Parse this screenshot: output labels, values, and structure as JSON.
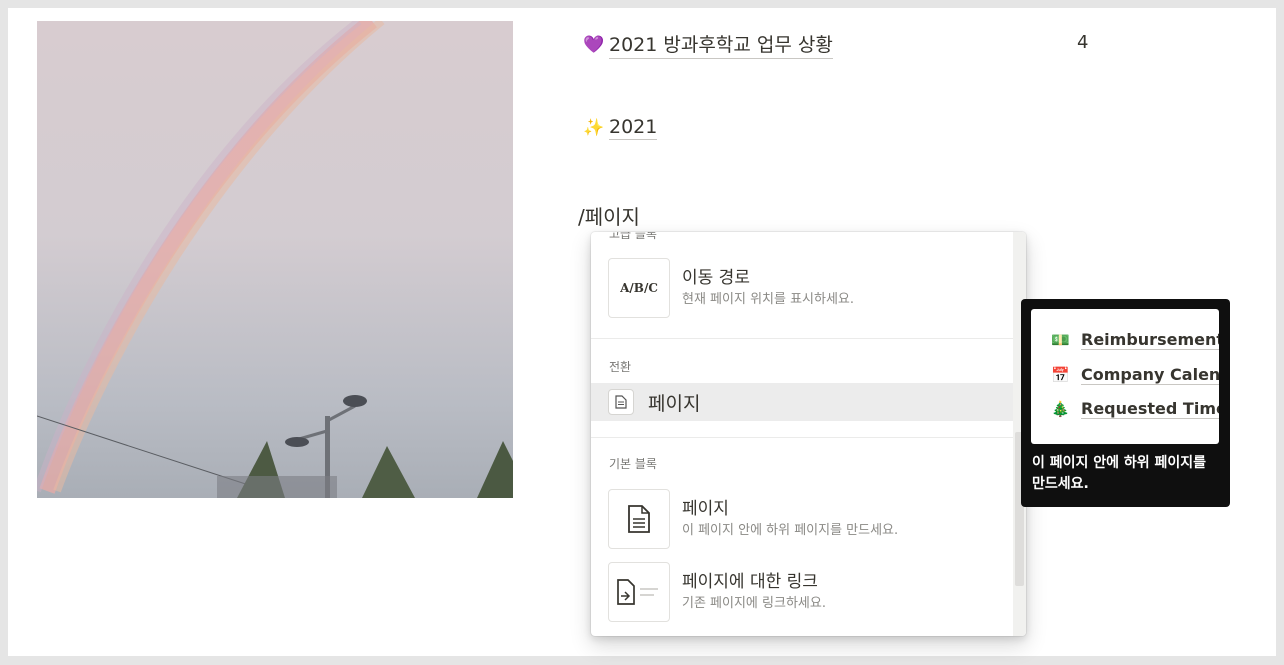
{
  "links": [
    {
      "emoji": "💜",
      "text": "2021 방과후학교 업무 상황",
      "count": "4"
    },
    {
      "emoji": "✨",
      "text": "2021"
    }
  ],
  "editor_text": "/페이지",
  "menu": {
    "cut_header": "고급 블록",
    "breadcrumb": {
      "thumb": "A/B/C",
      "title": "이동 경로",
      "desc": "현재 페이지 위치를 표시하세요."
    },
    "convert_header": "전환",
    "convert_item": {
      "label": "페이지"
    },
    "basic_header": "기본 블록",
    "page_item": {
      "title": "페이지",
      "desc": "이 페이지 안에 하위 페이지를 만드세요."
    },
    "link_item": {
      "title": "페이지에 대한 링크",
      "desc": "기존 페이지에 링크하세요."
    }
  },
  "tooltip": {
    "preview_rows": [
      {
        "emoji": "💵",
        "text": "Reimbursement"
      },
      {
        "emoji": "📅",
        "text": "Company Calendar"
      },
      {
        "emoji": "🎄",
        "text": "Requested Time"
      }
    ],
    "text": "이 페이지 안에 하위 페이지를 만드세요."
  }
}
